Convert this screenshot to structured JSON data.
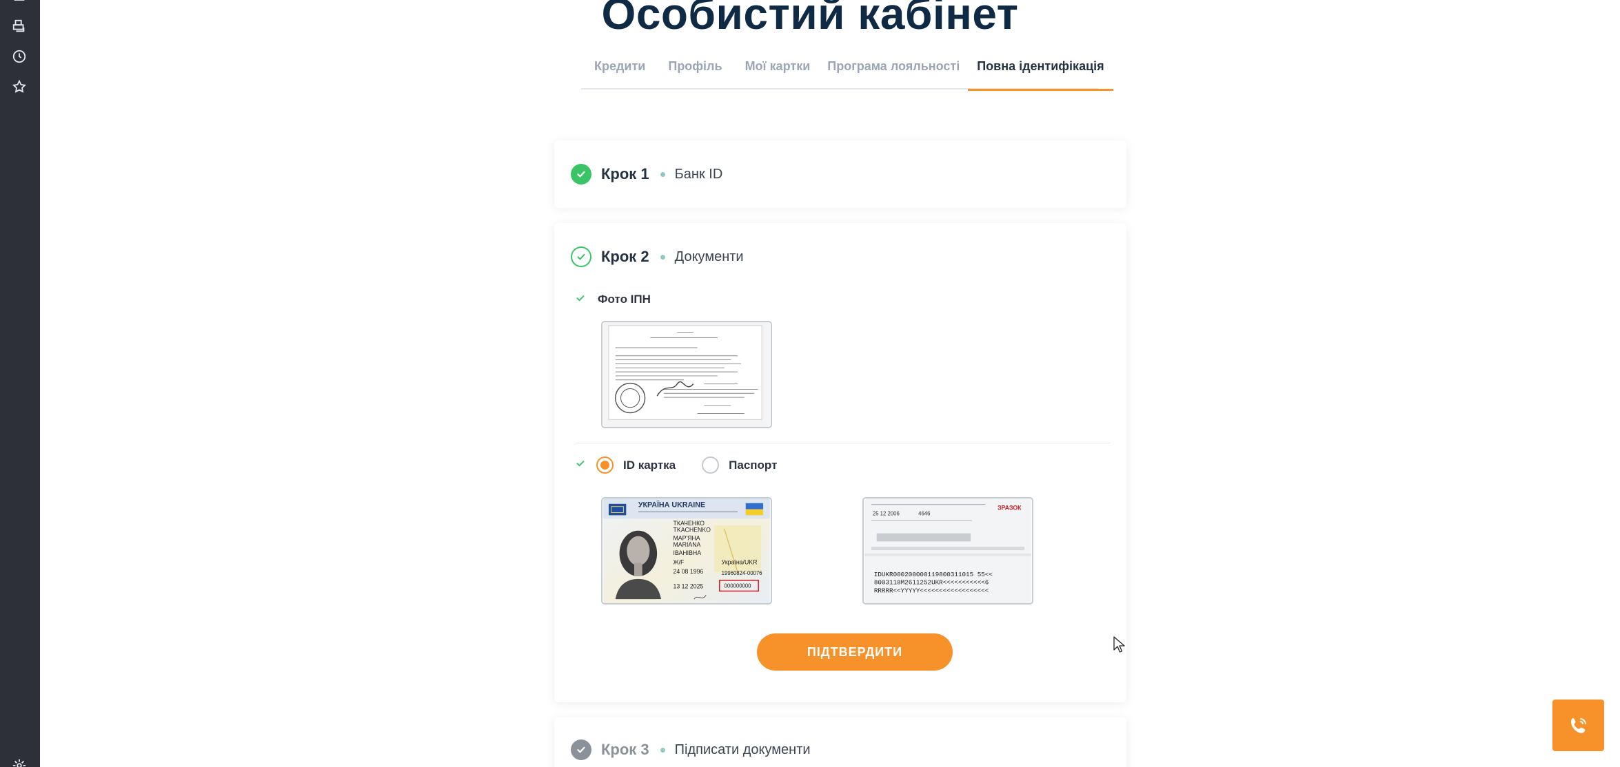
{
  "page": {
    "title": "Особистий кабінет"
  },
  "tabs": [
    {
      "label": "Кредити",
      "active": false
    },
    {
      "label": "Профіль",
      "active": false
    },
    {
      "label": "Мої картки",
      "active": false
    },
    {
      "label": "Програма лояльності",
      "active": false
    },
    {
      "label": "Повна ідентифікація",
      "active": true
    }
  ],
  "sidebar": {
    "icons": [
      "menu-icon",
      "printer-icon",
      "history-icon",
      "star-icon",
      "settings-icon"
    ]
  },
  "steps": [
    {
      "number": "Крок 1",
      "label": "Банк ID",
      "status": "done"
    },
    {
      "number": "Крок 2",
      "label": "Документи",
      "status": "in-progress",
      "ipn": {
        "label": "Фото ІПН"
      },
      "doc_type": {
        "options": [
          {
            "label": "ID картка",
            "selected": true
          },
          {
            "label": "Паспорт",
            "selected": false
          }
        ]
      },
      "id_card_front": {
        "header": "УКРАЇНА UKRAINE",
        "surname": "ТКАЧЕНКО",
        "surname_latin": "TKACHENKO",
        "given_name": "МАР'ЯНА",
        "given_name_latin": "MARIANA",
        "patronymic": "ІВАНІВНА",
        "sex": "Ж/F",
        "nationality": "Україна/UKR",
        "birth_date": "24 08 1996",
        "record_no": "19960824-00076",
        "expiry": "13 12 2025",
        "doc_no": "000000000"
      },
      "id_card_back": {
        "stamp": "ЗРАЗОК",
        "issue_date": "25 12 2006",
        "authority": "4646",
        "mrz_1": "IDUKR000200000119800311015 55<<",
        "mrz_2": "8003118M2611252UKR<<<<<<<<<<<6",
        "mrz_3": "RRRRR<<YYYYY<<<<<<<<<<<<<<<<<<"
      },
      "confirm_label": "ПІДТВЕРДИТИ"
    },
    {
      "number": "Крок 3",
      "label": "Підписати документи",
      "status": "pending"
    }
  ],
  "colors": {
    "accent": "#f7922a",
    "success": "#39c566",
    "title": "#0f2a44",
    "sidebar": "#2d3038"
  }
}
